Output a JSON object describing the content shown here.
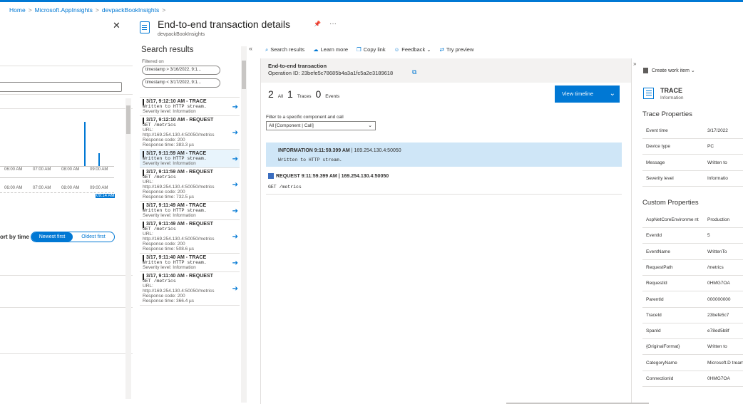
{
  "breadcrumb": {
    "home": "Home",
    "mid": "Microsoft.AppInsights",
    "leaf": "devpackBookInsights",
    "sep": ">"
  },
  "left": {
    "close": "✕",
    "axis_top": [
      "06:00 AM",
      "07:00 AM",
      "08:00 AM",
      "09:00 AM"
    ],
    "axis_bottom": [
      "06:00 AM",
      "07:00 AM",
      "08:00 AM",
      "09:00 AM"
    ],
    "axis_marker": "09:14 AM",
    "sort_label": "ort by time",
    "sort_on": "Newest first",
    "sort_off": "Oldest first"
  },
  "title": {
    "text": "End-to-end transaction details",
    "subtitle": "devpackBookInsights",
    "pin": "📌",
    "more": "···"
  },
  "search": {
    "heading": "Search results",
    "filtered_on": "Filtered on",
    "filters": [
      "timestamp > 3/16/2022, 9:1...",
      "timestamp < 3/17/2022, 9:1..."
    ],
    "collapse": "«",
    "items": [
      {
        "hd": "3/17, 9:12:10 AM - TRACE",
        "lines": [
          {
            "t": "Written to HTTP stream.",
            "mono": true
          },
          {
            "t": "Severity level: Information",
            "mono": false
          }
        ],
        "sel": false
      },
      {
        "hd": "3/17, 9:12:10 AM - REQUEST",
        "lines": [
          {
            "t": "GET /metrics",
            "mono": true
          },
          {
            "t": "URL:",
            "mono": false
          },
          {
            "t": "http://169.254.130.4:50050/metrics",
            "mono": false
          },
          {
            "t": "Response code: 200",
            "mono": false
          },
          {
            "t": "Response time: 383.3 µs",
            "mono": false
          }
        ],
        "sel": false
      },
      {
        "hd": "3/17, 9:11:59 AM - TRACE",
        "lines": [
          {
            "t": "Written to HTTP stream.",
            "mono": true
          },
          {
            "t": "Severity level: Information",
            "mono": false
          }
        ],
        "sel": true
      },
      {
        "hd": "3/17, 9:11:59 AM - REQUEST",
        "lines": [
          {
            "t": "GET /metrics",
            "mono": true
          },
          {
            "t": "URL:",
            "mono": false
          },
          {
            "t": "http://169.254.130.4:50050/metrics",
            "mono": false
          },
          {
            "t": "Response code: 200",
            "mono": false
          },
          {
            "t": "Response time: 732.5 µs",
            "mono": false
          }
        ],
        "sel": false
      },
      {
        "hd": "3/17, 9:11:49 AM - TRACE",
        "lines": [
          {
            "t": "Written to HTTP stream.",
            "mono": true
          },
          {
            "t": "Severity level: Information",
            "mono": false
          }
        ],
        "sel": false
      },
      {
        "hd": "3/17, 9:11:49 AM - REQUEST",
        "lines": [
          {
            "t": "GET /metrics",
            "mono": true
          },
          {
            "t": "URL:",
            "mono": false
          },
          {
            "t": "http://169.254.130.4:50050/metrics",
            "mono": false
          },
          {
            "t": "Response code: 200",
            "mono": false
          },
          {
            "t": "Response time: 508.6 µs",
            "mono": false
          }
        ],
        "sel": false
      },
      {
        "hd": "3/17, 9:11:40 AM - TRACE",
        "lines": [
          {
            "t": "Written to HTTP stream.",
            "mono": true
          },
          {
            "t": "Severity level: Information",
            "mono": false
          }
        ],
        "sel": false
      },
      {
        "hd": "3/17, 9:11:40 AM - REQUEST",
        "lines": [
          {
            "t": "GET /metrics",
            "mono": true
          },
          {
            "t": "URL:",
            "mono": false
          },
          {
            "t": "http://169.254.130.4:50050/metrics",
            "mono": false
          },
          {
            "t": "Response code: 200",
            "mono": false
          },
          {
            "t": "Response time: 366.4 µs",
            "mono": false
          }
        ],
        "sel": false
      }
    ]
  },
  "toolbar": {
    "search": "Search results",
    "learn": "Learn more",
    "copy": "Copy link",
    "feedback": "Feedback",
    "try": "Try preview"
  },
  "e2e": {
    "header": "End-to-end transaction",
    "opid": "Operation ID: 23befe5c78685b4a3a1fc5a2e3189618",
    "counts": [
      {
        "n": "2",
        "l": "All"
      },
      {
        "n": "1",
        "l": "Traces"
      },
      {
        "n": "0",
        "l": "Events"
      }
    ],
    "view_timeline": "View timeline",
    "filter_label": "Filter to a specific component and call",
    "filter_value": "All [Component | Call]",
    "row1_head": "INFORMATION  9:11:59.399 AM",
    "row1_ip": "|  169.254.130.4:50050",
    "row1_msg": "Written to HTTP stream.",
    "row2_head": "REQUEST  9:11:59.399 AM  |  169.254.130.4:50050",
    "row2_msg": "GET /metrics"
  },
  "props": {
    "expand": "»",
    "create_work_item": "Create work item",
    "trace_title": "TRACE",
    "trace_sub": "Information",
    "trace_heading": "Trace Properties",
    "trace_props": [
      {
        "k": "Event time",
        "v": "3/17/2022"
      },
      {
        "k": "Device type",
        "v": "PC"
      },
      {
        "k": "Message",
        "v": "Written to"
      },
      {
        "k": "Severity level",
        "v": "Informatio"
      }
    ],
    "custom_heading": "Custom Properties",
    "custom_props": [
      {
        "k": "AspNetCoreEnvironme nt",
        "v": "Production"
      },
      {
        "k": "EventId",
        "v": "5"
      },
      {
        "k": "EventName",
        "v": "WrittenTo"
      },
      {
        "k": "RequestPath",
        "v": "/metrics"
      },
      {
        "k": "RequestId",
        "v": "0HMG7OA"
      },
      {
        "k": "ParentId",
        "v": "000000000"
      },
      {
        "k": "TraceId",
        "v": "23befe5c7"
      },
      {
        "k": "SpanId",
        "v": "e78ed5b8f"
      },
      {
        "k": "{OriginalFormat}",
        "v": "Written to"
      },
      {
        "k": "CategoryName",
        "v": "Microsoft.D treamResu"
      },
      {
        "k": "ConnectionId",
        "v": "0HMG7OA"
      }
    ]
  }
}
